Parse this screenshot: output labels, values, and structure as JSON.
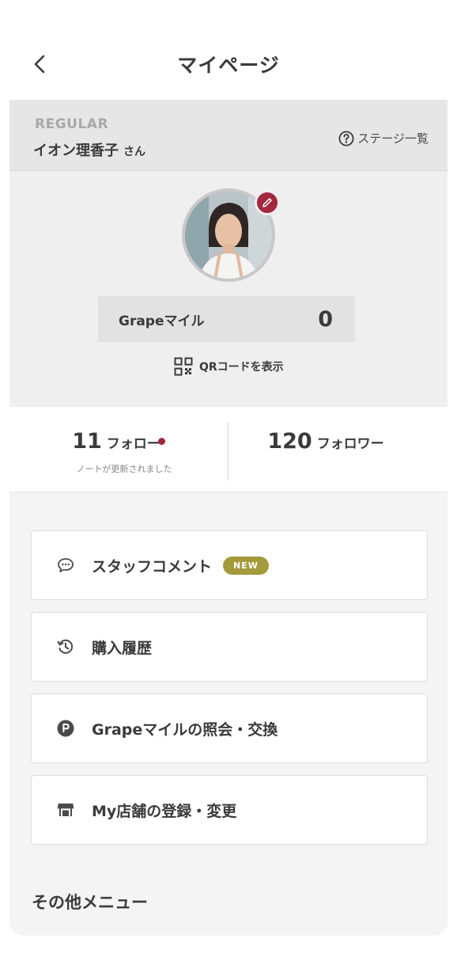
{
  "header": {
    "title": "マイページ"
  },
  "stage": {
    "level": "REGULAR",
    "user_name": "イオン理香子",
    "honorific": "さん",
    "list_link": "ステージ一覧"
  },
  "miles": {
    "label": "Grapeマイル",
    "value": "0"
  },
  "qr": {
    "label": "QRコードを表示"
  },
  "follow": {
    "following_count": "11",
    "following_label": "フォロー",
    "note": "ノートが更新されました",
    "followers_count": "120",
    "followers_label": "フォロワー"
  },
  "menu": {
    "items": [
      {
        "label": "スタッフコメント",
        "badge": "NEW",
        "icon": "chat-bubble-icon"
      },
      {
        "label": "購入履歴",
        "icon": "history-icon"
      },
      {
        "label": "Grapeマイルの照会・交換",
        "icon": "points-icon"
      },
      {
        "label": "My店舗の登録・変更",
        "icon": "store-icon"
      }
    ],
    "section_title": "その他メニュー"
  },
  "colors": {
    "accent": "#a3283e",
    "badge": "#a49a3b",
    "background": "#efefef"
  }
}
